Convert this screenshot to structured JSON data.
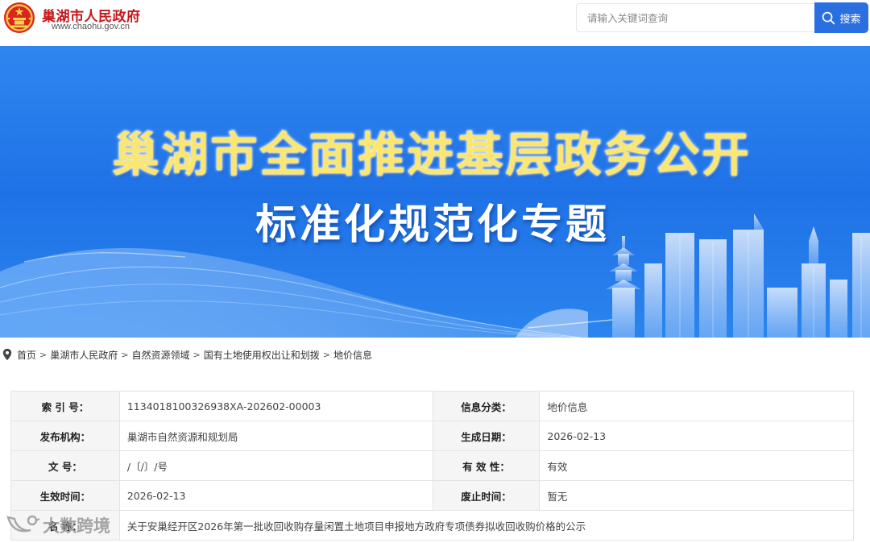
{
  "header": {
    "site_name": "巢湖市人民政府",
    "site_url": "www.chaohu.gov.cn",
    "search_placeholder": "请输入关键词查询",
    "search_button": "搜索"
  },
  "banner": {
    "title_line1": "巢湖市全面推进基层政务公开",
    "title_line2": "标准化规范化专题"
  },
  "breadcrumb": {
    "items": [
      "首页",
      "巢湖市人民政府",
      "自然资源领域",
      "国有土地使用权出让和划拨",
      "地价信息"
    ],
    "separator": ">"
  },
  "info": {
    "index_label": "索  引  号：",
    "index_value": "1134018100326938XA-202602-00003",
    "category_label": "信息分类：",
    "category_value": "地价信息",
    "publisher_label": "发布机构：",
    "publisher_value": "巢湖市自然资源和规划局",
    "gen_date_label": "生成日期：",
    "gen_date_value": "2026-02-13",
    "doc_no_label": "文      号：",
    "doc_no_value": "/〔/〕/号",
    "validity_label": "有  效  性：",
    "validity_value": "有效",
    "effective_label": "生效时间：",
    "effective_value": "2026-02-13",
    "expire_label": "废止时间：",
    "expire_value": "暂无",
    "name_label": "名      称：",
    "name_value": "关于安巢经开区2026年第一批收回收购存量闲置土地项目申报地方政府专项债券拟收回收购价格的公示"
  },
  "watermark": {
    "text": "大数跨境"
  },
  "colors": {
    "brand_red": "#c8161d",
    "search_blue": "#2a6fe0",
    "banner_blue": "#2479ea",
    "banner_gold": "#fbe66f"
  },
  "icons": {
    "emblem": "national-emblem-icon",
    "search": "search-icon",
    "location": "location-pin-icon",
    "watermark": "bird-logo-icon"
  }
}
